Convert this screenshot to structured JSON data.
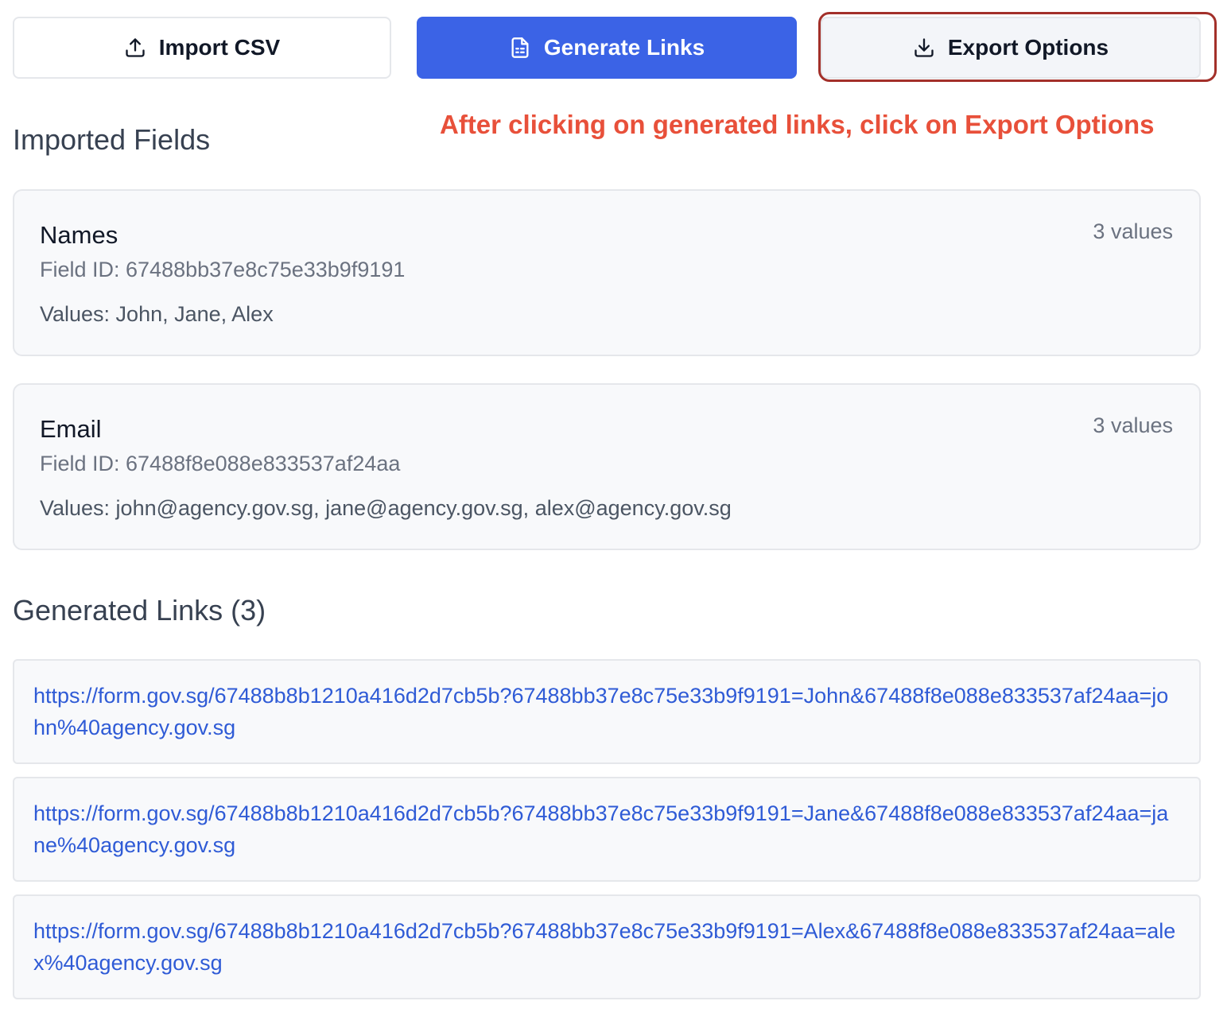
{
  "toolbar": {
    "import_label": "Import CSV",
    "generate_label": "Generate Links",
    "export_label": "Export Options",
    "primary_color": "#3b63e6"
  },
  "annotation": {
    "text": "After clicking on generated links, click on Export Options",
    "color": "#e8503a",
    "highlight_color": "#a3302a"
  },
  "imported_fields": {
    "title": "Imported Fields",
    "fields": [
      {
        "name": "Names",
        "count": "3 values",
        "field_id": "Field ID: 67488bb37e8c75e33b9f9191",
        "values": "Values: John, Jane, Alex"
      },
      {
        "name": "Email",
        "count": "3 values",
        "field_id": "Field ID: 67488f8e088e833537af24aa",
        "values": "Values: john@agency.gov.sg, jane@agency.gov.sg, alex@agency.gov.sg"
      }
    ]
  },
  "generated_links": {
    "title": "Generated Links (3)",
    "links": [
      "https://form.gov.sg/67488b8b1210a416d2d7cb5b?67488bb37e8c75e33b9f9191=John&67488f8e088e833537af24aa=john%40agency.gov.sg",
      "https://form.gov.sg/67488b8b1210a416d2d7cb5b?67488bb37e8c75e33b9f9191=Jane&67488f8e088e833537af24aa=jane%40agency.gov.sg",
      "https://form.gov.sg/67488b8b1210a416d2d7cb5b?67488bb37e8c75e33b9f9191=Alex&67488f8e088e833537af24aa=alex%40agency.gov.sg"
    ],
    "link_color": "#2f5bd6"
  }
}
